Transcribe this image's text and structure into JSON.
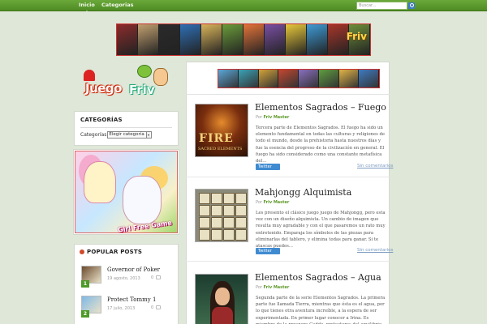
{
  "nav": {
    "items": [
      {
        "label": "Inicio",
        "active": true
      },
      {
        "label": "Categorias",
        "active": false
      }
    ],
    "search_placeholder": "Buscar...",
    "search_icon": "search-icon"
  },
  "logo": {
    "word1": "Juego",
    "word2": "Friv"
  },
  "banner": {
    "logo_text": "Friv",
    "tile_colors": [
      "#8b2c2c",
      "#c2a070",
      "#2b2b2b",
      "#2e6fb5",
      "#d9b45a",
      "#6b9c3a",
      "#e3733a",
      "#7a4fa3",
      "#e8c83a",
      "#3d9bd6",
      "#a8362a",
      "#6d8f3a"
    ]
  },
  "strip": {
    "tile_colors": [
      "#5aa7d8",
      "#3aa3b7",
      "#d2a23a",
      "#c4472f",
      "#8a6fbf",
      "#5f9d3f",
      "#e2b346",
      "#3e7bc2"
    ]
  },
  "categories_widget": {
    "title": "CATEGORÍAS",
    "label": "Categorías",
    "select_value": "Elegir categoría"
  },
  "ad": {
    "badge": "Girl Free Game"
  },
  "popular_posts": {
    "title": "POPULAR POSTS",
    "items": [
      {
        "num": "1",
        "title": "Governor of Poker",
        "date": "19 agosto, 2013",
        "comments": "0",
        "thumb_color": "#6b4a2e"
      },
      {
        "num": "2",
        "title": "Protect Tommy 1",
        "date": "17 julio, 2013",
        "comments": "0",
        "thumb_color": "#7fb8e6"
      }
    ]
  },
  "posts": [
    {
      "title": "Elementos Sagrados – Fuego",
      "by_prefix": "Por",
      "author": "Friv Master",
      "excerpt": "Tercera parte de Elementos Sagrados. El fuego ha sido un elemento fundamental en todas las culturas y religiones de todo el mundo, desde la prehistoria hasta nuestros días y fue la esencia del progreso de la civilización en general. El fuego ha sido considerado como una constante metafísica del...",
      "tweet": "Twitter",
      "comments": "Sin comentarios",
      "thumb_text": "FIRE",
      "thumb_sub": "SACRED ELEMENTS",
      "thumb_color": "#3a1c10"
    },
    {
      "title": "Mahjongg Alquimista",
      "by_prefix": "Por",
      "author": "Friv Master",
      "excerpt": "Les presento el clásico juego juego de Mahjongg, pero esta vez con un diseño alquimista. Un cambio de imagen que resulta muy agradable y con el que pasaremos un rato muy entretenido. Emparaja los símbolos de las piezas para eliminarlas del tablero, y elimina todas para ganar. Si te atascas puedes...",
      "tweet": "Twitter",
      "comments": "Sin comentarios",
      "thumb_text": "",
      "thumb_sub": "",
      "thumb_color": "#8a8a7a"
    },
    {
      "title": "Elementos Sagrados – Agua",
      "by_prefix": "Por",
      "author": "Friv Master",
      "excerpt": "Segunda parte de la serie Elementos Sagrados. La primera parte fue llamada Tierra, mientras que ésta es el agua, por lo que tienes otra aventura increíble, a la espera de ser experimentada. En primer lugar conocer a Irina. Es miembro de la prospera Caddo, protectores del equilibrio en la naturaleza. Esta...",
      "tweet": "Twitter",
      "comments": "Sin comentarios",
      "thumb_text": "",
      "thumb_sub": "",
      "thumb_color": "#244a3a"
    }
  ]
}
